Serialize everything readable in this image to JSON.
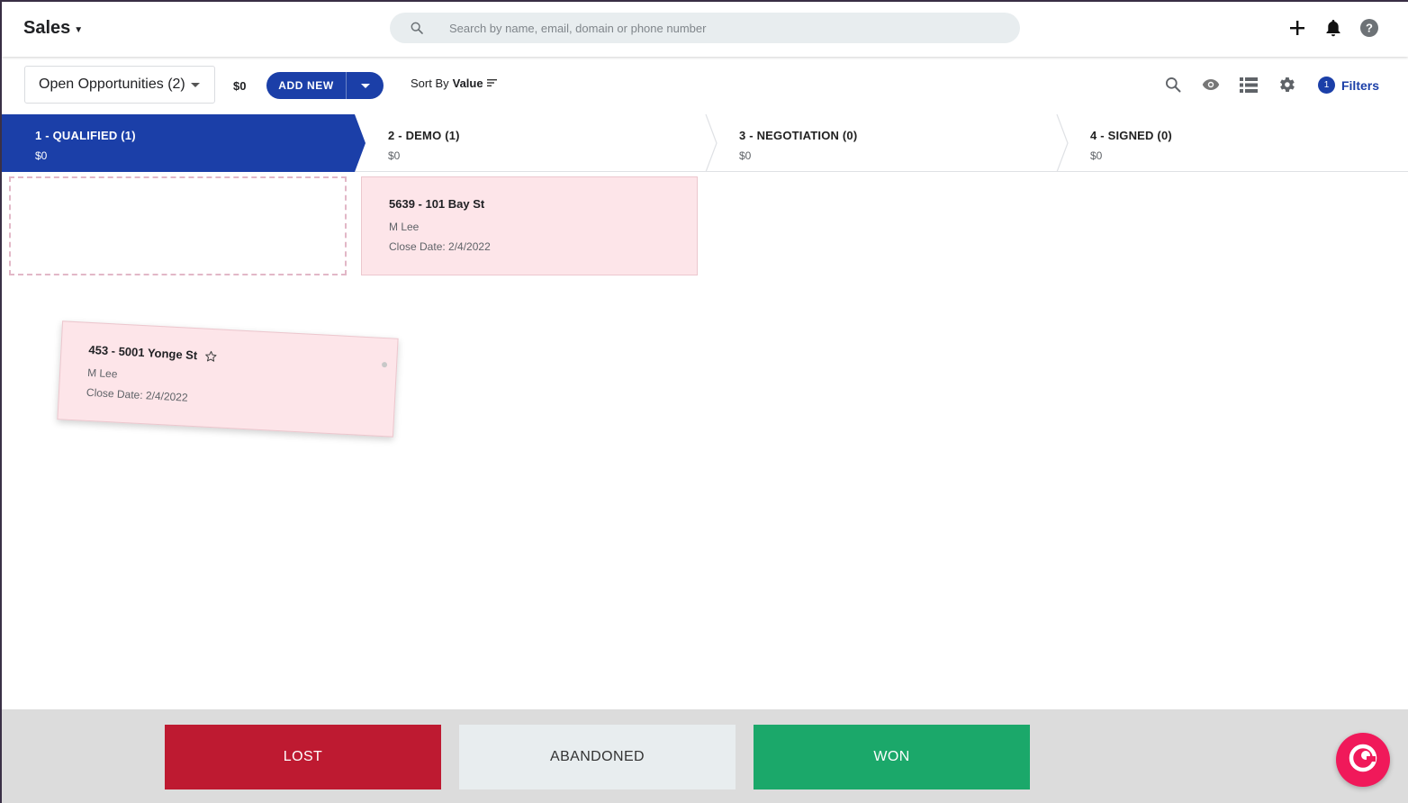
{
  "header": {
    "app_title": "Sales",
    "search_placeholder": "Search by name, email, domain or phone number"
  },
  "toolbar": {
    "view_label": "Open Opportunities (2)",
    "total_value": "$0",
    "add_new_label": "ADD NEW",
    "sort_prefix": "Sort By",
    "sort_field": "Value",
    "filters_count": "1",
    "filters_label": "Filters"
  },
  "stages": [
    {
      "title": "1 - QUALIFIED (1)",
      "value": "$0",
      "active": true
    },
    {
      "title": "2 - DEMO (1)",
      "value": "$0",
      "active": false
    },
    {
      "title": "3 - NEGOTIATION (0)",
      "value": "$0",
      "active": false
    },
    {
      "title": "4 - SIGNED (0)",
      "value": "$0",
      "active": false
    }
  ],
  "cards": [
    {
      "title": "5639 - 101 Bay St",
      "owner": "M Lee",
      "close_date": "Close Date: 2/4/2022"
    },
    {
      "title": "453 - 5001 Yonge St",
      "owner": "M Lee",
      "close_date": "Close Date: 2/4/2022"
    }
  ],
  "dropzones": {
    "lost": "LOST",
    "abandoned": "ABANDONED",
    "won": "WON"
  },
  "colors": {
    "primary": "#1b3fa8",
    "card_bg": "#fde5e9",
    "lost": "#be1a31",
    "won": "#1ba86a",
    "chat": "#f0195a"
  },
  "icons": {
    "search": "search-icon",
    "add": "plus-icon",
    "notifications": "bell-icon",
    "help": "help-icon",
    "view": "eye-icon",
    "list": "list-icon",
    "settings": "gear-icon",
    "favorite": "star-icon",
    "chat": "chat-icon"
  }
}
